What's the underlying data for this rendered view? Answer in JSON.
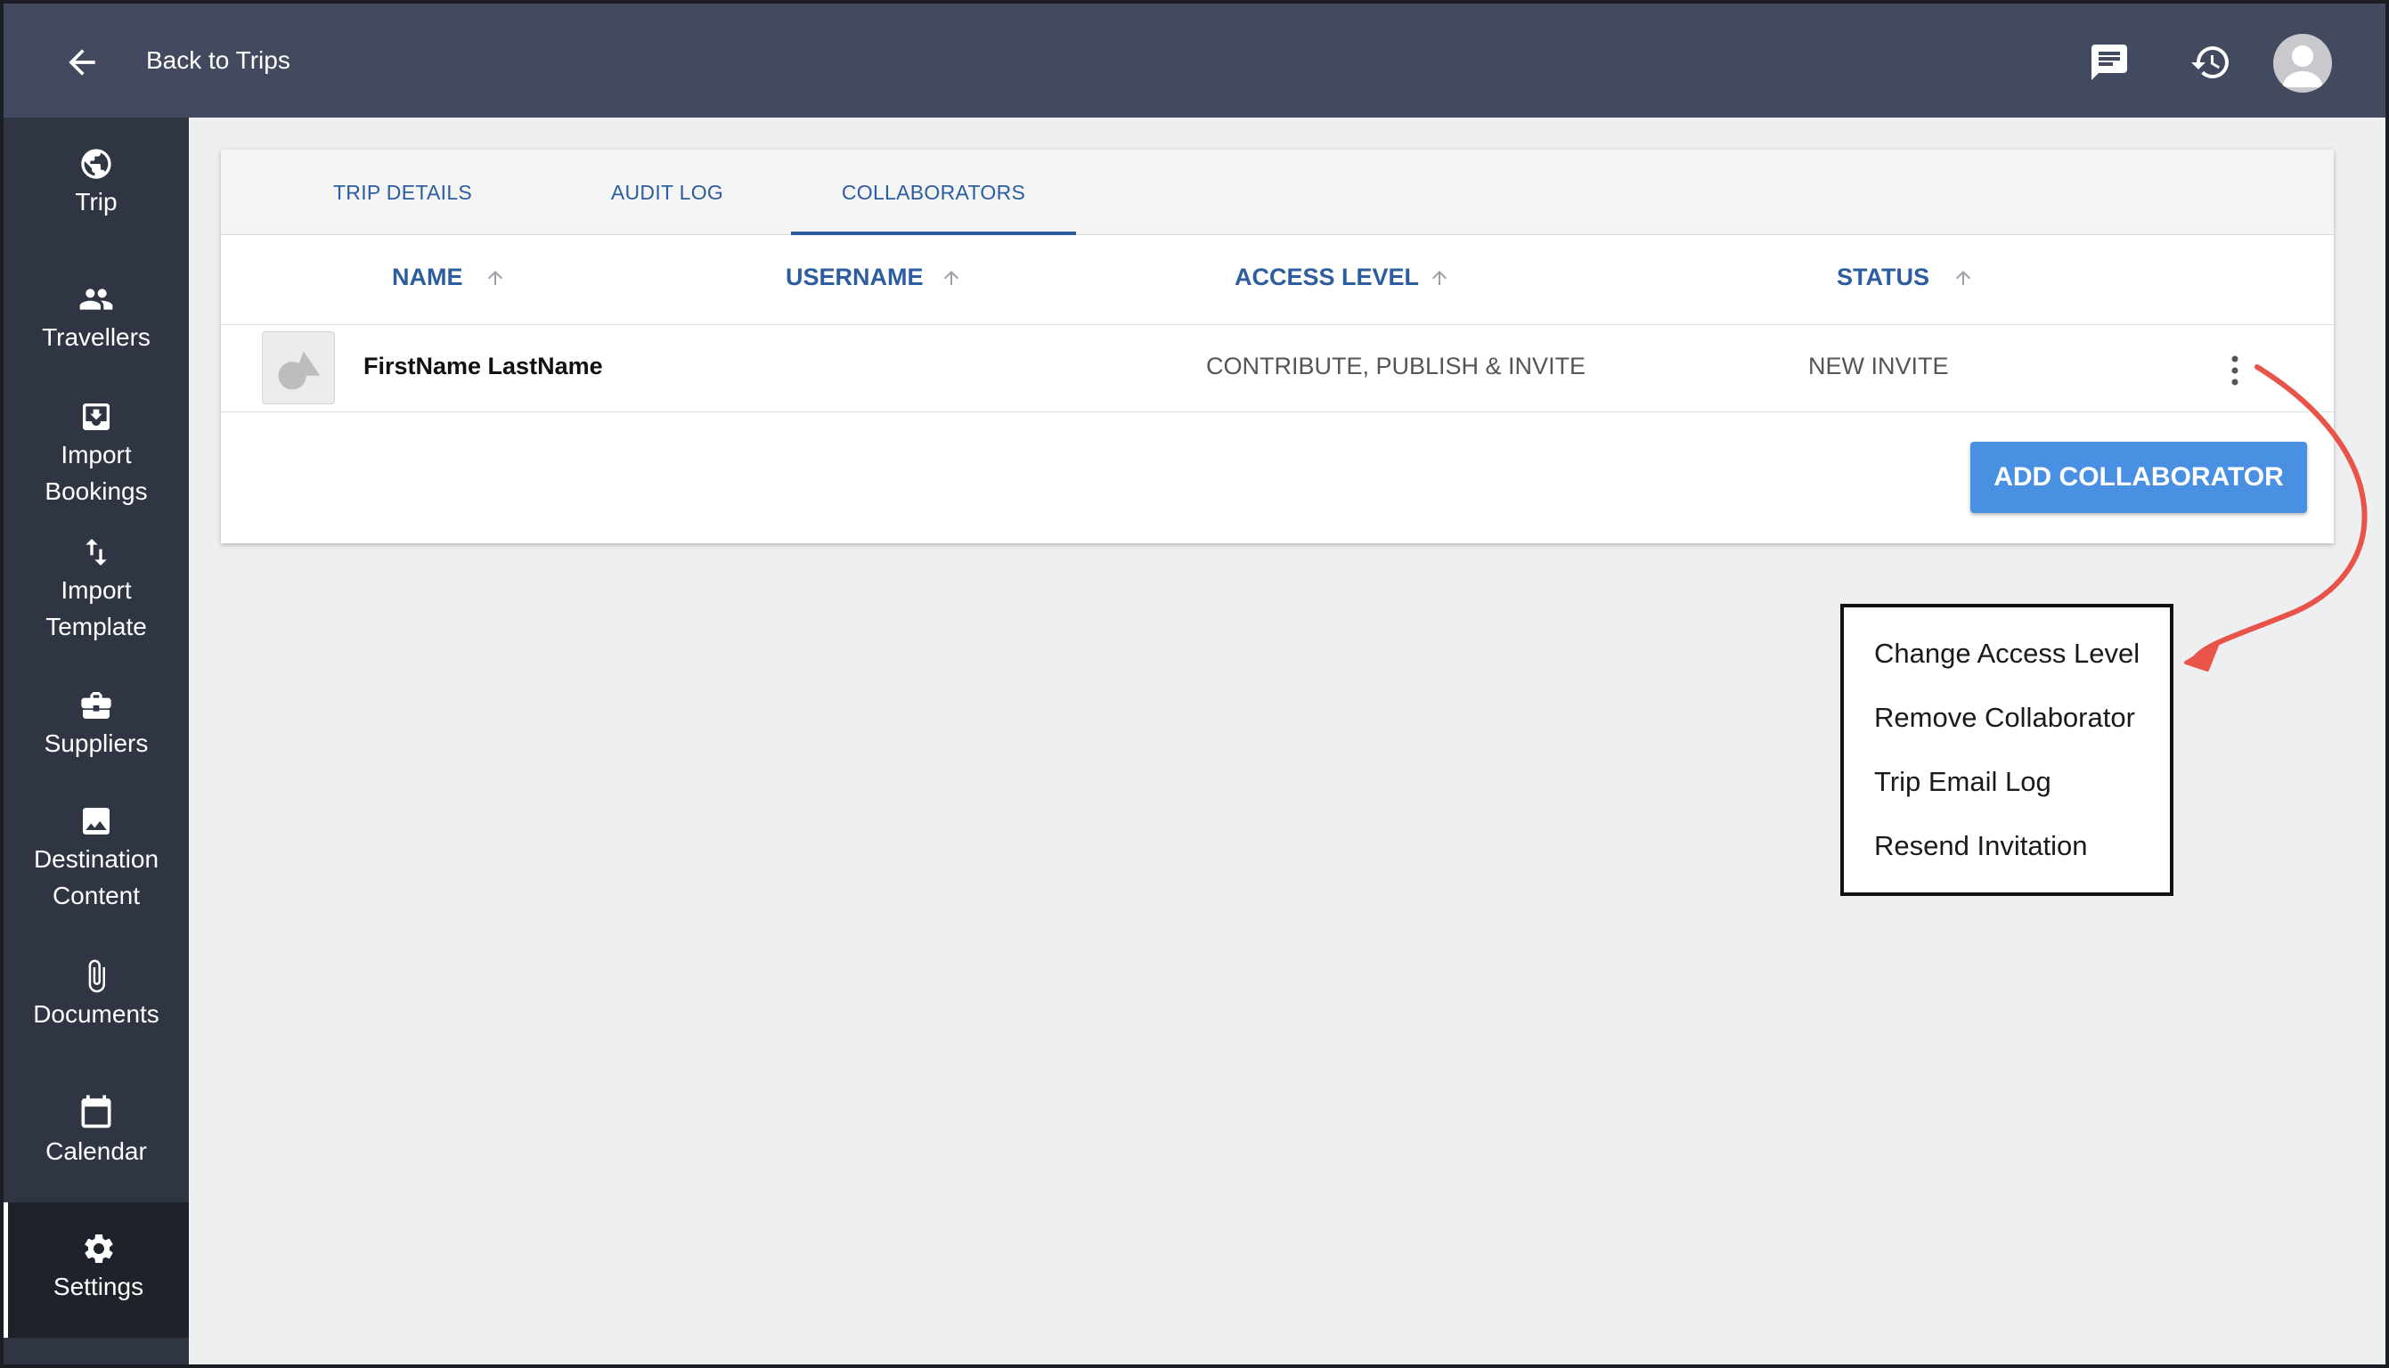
{
  "header": {
    "back_label": "Back to Trips"
  },
  "sidebar": {
    "items": [
      {
        "line1": "Trip",
        "line2": ""
      },
      {
        "line1": "Travellers",
        "line2": ""
      },
      {
        "line1": "Import",
        "line2": "Bookings"
      },
      {
        "line1": "Import",
        "line2": "Template"
      },
      {
        "line1": "Suppliers",
        "line2": ""
      },
      {
        "line1": "Destination",
        "line2": "Content"
      },
      {
        "line1": "Documents",
        "line2": ""
      },
      {
        "line1": "Calendar",
        "line2": ""
      },
      {
        "line1": "Settings",
        "line2": ""
      }
    ],
    "active": "Settings"
  },
  "tabs": [
    "TRIP DETAILS",
    "AUDIT LOG",
    "COLLABORATORS"
  ],
  "selected_tab": "COLLABORATORS",
  "table": {
    "columns": [
      "NAME",
      "USERNAME",
      "ACCESS LEVEL",
      "STATUS"
    ],
    "rows": [
      {
        "name": "FirstName LastName",
        "username": "",
        "access_level": "CONTRIBUTE, PUBLISH & INVITE",
        "status": "NEW INVITE"
      }
    ]
  },
  "add_button": "ADD COLLABORATOR",
  "menu": {
    "items": [
      "Change Access Level",
      "Remove Collaborator",
      "Trip Email Log",
      "Resend Invitation"
    ]
  },
  "colors": {
    "topbar": "#434a5f",
    "sidebar": "#2f3542",
    "accent": "#2c5d9e",
    "button": "#4a90e2",
    "annotation_arrow": "#e8534a"
  }
}
